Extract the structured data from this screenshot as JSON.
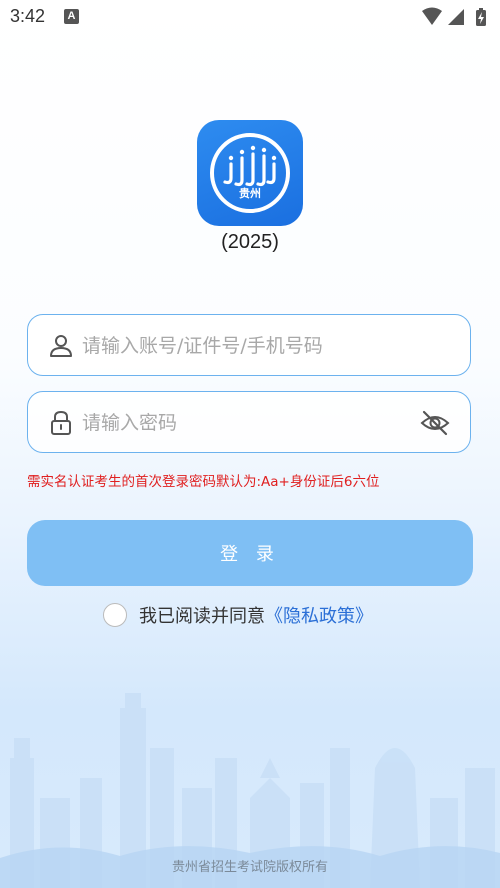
{
  "status_bar": {
    "time": "3:42",
    "notification_badge": "A",
    "icons": [
      "wifi-icon",
      "cellular-signal-icon",
      "battery-charging-icon"
    ]
  },
  "app": {
    "icon": "app-logo-icon",
    "logo_text": "贵州",
    "version": "(2025)"
  },
  "login_form": {
    "account_placeholder": "请输入账号/证件号/手机号码",
    "password_placeholder": "请输入密码",
    "account_icon": "user-icon",
    "password_icon": "lock-icon",
    "visibility_icon": "eye-off-icon",
    "notice": "需实名认证考生的首次登录密码默认为:Aa+身份证后6六位",
    "login_button": "登 录",
    "agree_text": "我已阅读并同意",
    "privacy_link": "《隐私政策》"
  },
  "footer": {
    "copyright": "贵州省招生考试院版权所有"
  },
  "colors": {
    "accent": "#2e8cf0",
    "field_border": "#6cb2ee",
    "button": "#7fbff4",
    "notice": "#e02020",
    "link": "#2b6fd6"
  }
}
